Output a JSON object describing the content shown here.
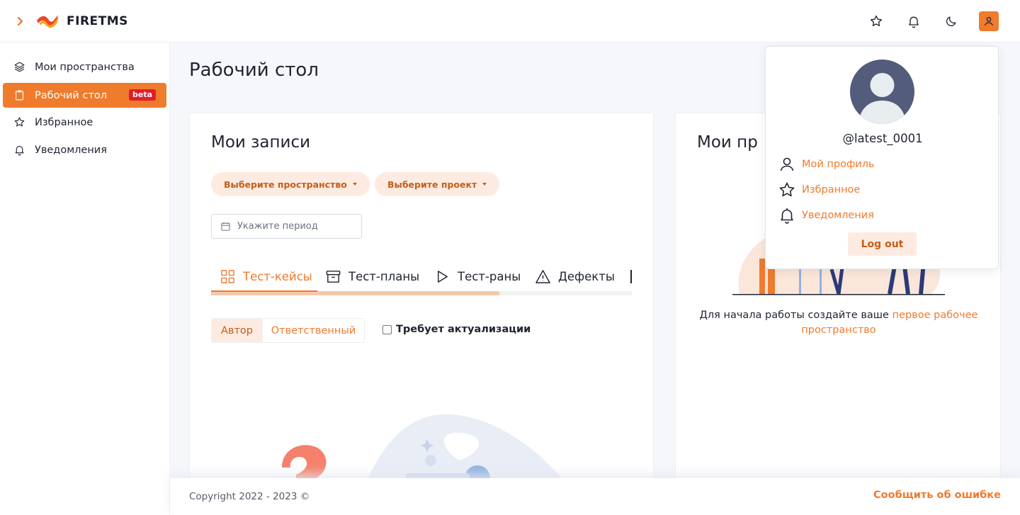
{
  "header": {
    "logo_text": "FIRETMS",
    "icons": [
      "star-icon",
      "bell-icon",
      "moon-icon",
      "user-icon"
    ]
  },
  "sidebar": {
    "items": [
      {
        "label": "Мои пространства",
        "icon": "layers-icon"
      },
      {
        "label": "Рабочий стол",
        "icon": "clipboard-icon",
        "badge": "beta",
        "active": true
      },
      {
        "label": "Избранное",
        "icon": "star-icon"
      },
      {
        "label": "Уведомления",
        "icon": "bell-icon"
      }
    ]
  },
  "main": {
    "title": "Рабочий стол",
    "records": {
      "title": "Мои записи",
      "space_select": "Выберите пространство",
      "project_select": "Выберите проект",
      "period_placeholder": "Укажите период",
      "tabs": [
        {
          "label": "Тест-кейсы",
          "icon": "grid-icon",
          "active": true
        },
        {
          "label": "Тест-планы",
          "icon": "archive-icon"
        },
        {
          "label": "Тест-раны",
          "icon": "play-icon"
        },
        {
          "label": "Дефекты",
          "icon": "warning-icon"
        }
      ],
      "filter_author": "Автор",
      "filter_responsible": "Ответственный",
      "needs_update_label": "Требует актуализации"
    },
    "projects": {
      "title": "Мои пр",
      "empty_text": "Для начала работы создайте ваше ",
      "empty_link": "первое рабочее пространство"
    }
  },
  "footer": {
    "copyright": "Copyright 2022 - 2023 ©",
    "report_bug": "Сообщить об ошибке"
  },
  "user_menu": {
    "username": "@latest_0001",
    "items": [
      {
        "label": "Мой профиль",
        "icon": "user-icon"
      },
      {
        "label": "Избранное",
        "icon": "star-icon"
      },
      {
        "label": "Уведомления",
        "icon": "bell-icon"
      }
    ],
    "logout": "Log out"
  },
  "colors": {
    "accent": "#ef7b2d",
    "accent_soft": "#fdebe1",
    "badge": "#e11d2a",
    "avatar_bg": "#535c7a"
  }
}
